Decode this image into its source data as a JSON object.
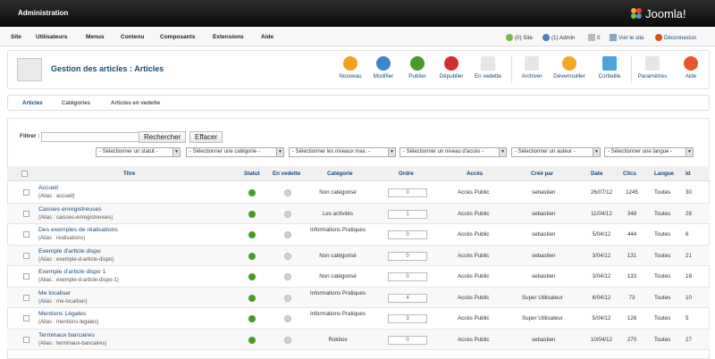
{
  "app": {
    "admin_title": "Administration",
    "logo_text": "Joomla!"
  },
  "menu": [
    "Site",
    "Utilisateurs",
    "Menus",
    "Contenu",
    "Composants",
    "Extensions",
    "Aide"
  ],
  "status": {
    "site": "(0) Site",
    "admin": "(1) Admin",
    "messages": "0",
    "view_site": "Voir le site",
    "logout": "Déconnexion"
  },
  "page": {
    "title": "Gestion des articles : Articles"
  },
  "toolbar": [
    "Nouveau",
    "Modifier",
    "Publier",
    "Dépublier",
    "En vedette",
    "Archiver",
    "Déverrouiller",
    "Corbeille",
    "Paramètres",
    "Aide"
  ],
  "subnav": [
    "Articles",
    "Catégories",
    "Articles en vedette"
  ],
  "filter": {
    "label": "Filtrer :",
    "search": "Rechercher",
    "reset": "Effacer",
    "value": ""
  },
  "selects": [
    "- Sélectionner un statut -",
    "- Sélectionner une catégorie -",
    "- Sélectionner les niveaux max. -",
    "- Sélectionner un niveau d'accès -",
    "- Sélectionner un auteur -",
    "- Sélectionner une langue -"
  ],
  "columns": [
    "Titre",
    "Statut",
    "En vedette",
    "Catégorie",
    "Ordre",
    "Accès",
    "Créé par",
    "Date",
    "Clics",
    "Langue",
    "Id"
  ],
  "rows": [
    {
      "title": "Accueil",
      "alias": "(Alias : accueil)",
      "category": "Non catégorisé",
      "order": "0",
      "access": "Accès Public",
      "author": "sebastien",
      "date": "26/07/12",
      "hits": "1245",
      "lang": "Toutes",
      "id": "30"
    },
    {
      "title": "Caisses enregistreuses",
      "alias": "(Alias : caisses-enregistreuses)",
      "category": "Les activités",
      "order": "1",
      "access": "Accès Public",
      "author": "sebastien",
      "date": "11/04/12",
      "hits": "348",
      "lang": "Toutes",
      "id": "28"
    },
    {
      "title": "Des exemples de réalisations",
      "alias": "(Alias : realisations)",
      "category": "Informations Pratiques",
      "order": "0",
      "access": "Accès Public",
      "author": "sebastien",
      "date": "5/04/12",
      "hits": "444",
      "lang": "Toutes",
      "id": "6"
    },
    {
      "title": "Exemple d'article dispo",
      "alias": "(Alias : exemple-d-article-dispo)",
      "category": "Non catégorisé",
      "order": "0",
      "access": "Accès Public",
      "author": "sebastien",
      "date": "3/04/12",
      "hits": "131",
      "lang": "Toutes",
      "id": "21"
    },
    {
      "title": "Exemple d'article dispo 1",
      "alias": "(Alias : exemple-d-article-dispo-1)",
      "category": "Non catégorisé",
      "order": "0",
      "access": "Accès Public",
      "author": "sebastien",
      "date": "3/04/12",
      "hits": "133",
      "lang": "Toutes",
      "id": "18"
    },
    {
      "title": "Me localiser",
      "alias": "(Alias : me-localiser)",
      "category": "Informations Pratiques",
      "order": "4",
      "access": "Accès Public",
      "author": "Super Utilisateur",
      "date": "6/04/12",
      "hits": "73",
      "lang": "Toutes",
      "id": "10"
    },
    {
      "title": "Mentions Légales",
      "alias": "(Alias : mentions-legales)",
      "category": "Informations Pratiques",
      "order": "3",
      "access": "Accès Public",
      "author": "Super Utilisateur",
      "date": "5/04/12",
      "hits": "126",
      "lang": "Toutes",
      "id": "5"
    },
    {
      "title": "Terminaux bancaires",
      "alias": "(Alias : terminaux-bancaires)",
      "category": "Rokbox",
      "order": "0",
      "access": "Accès Public",
      "author": "sebastien",
      "date": "10/04/12",
      "hits": "270",
      "lang": "Toutes",
      "id": "27"
    }
  ],
  "colors": {
    "link": "#1b4a78",
    "published": "#4a9a28",
    "topbar": "#111111"
  }
}
